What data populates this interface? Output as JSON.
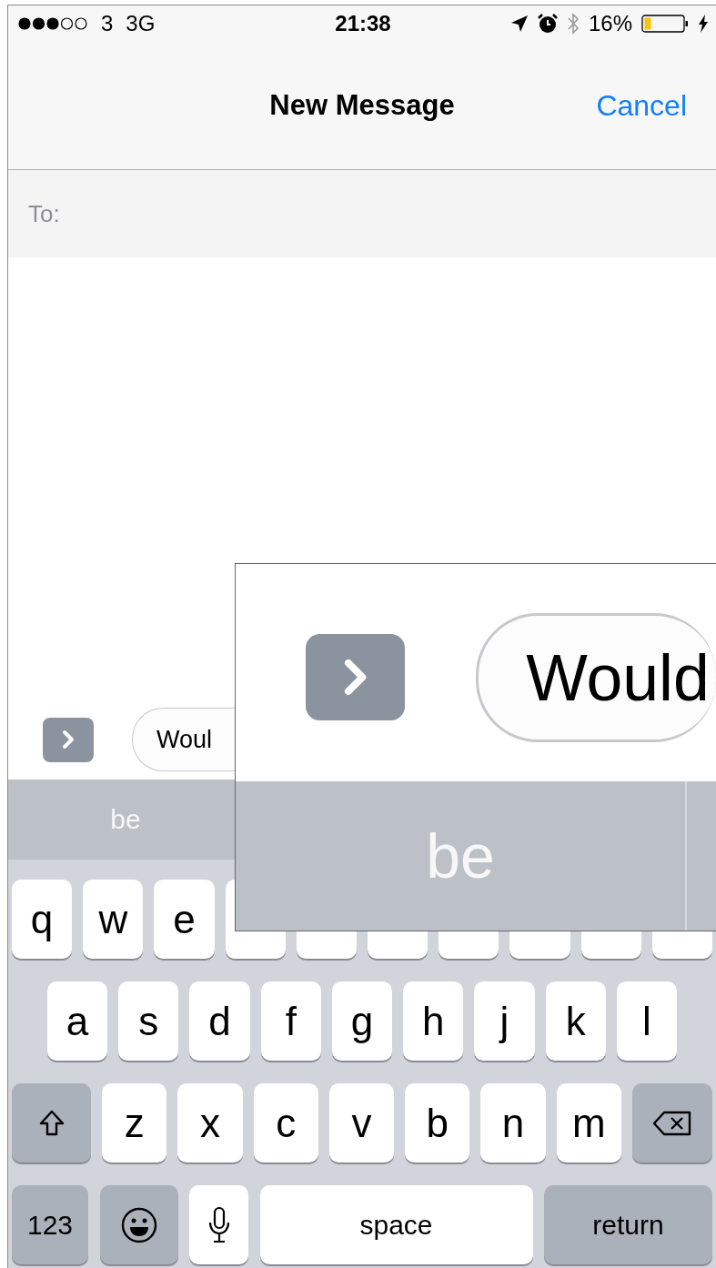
{
  "status_bar": {
    "carrier": "3",
    "network": "3G",
    "time": "21:38",
    "battery": "16%"
  },
  "nav_bar": {
    "title": "New Message",
    "cancel": "Cancel"
  },
  "recipient": {
    "label": "To:"
  },
  "composer": {
    "text": "Woul"
  },
  "suggestions": [
    {
      "label": "be"
    }
  ],
  "keyboard": {
    "rows": [
      {
        "keys": [
          {
            "kind": "letter",
            "label": "q"
          },
          {
            "kind": "letter",
            "label": "w"
          },
          {
            "kind": "letter",
            "label": "e"
          },
          {
            "kind": "covered"
          },
          {
            "kind": "covered"
          },
          {
            "kind": "covered"
          },
          {
            "kind": "covered"
          },
          {
            "kind": "covered"
          },
          {
            "kind": "covered"
          },
          {
            "kind": "covered"
          }
        ]
      },
      {
        "keys": [
          {
            "kind": "letter",
            "label": "a"
          },
          {
            "kind": "letter",
            "label": "s"
          },
          {
            "kind": "letter",
            "label": "d"
          },
          {
            "kind": "letter",
            "label": "f"
          },
          {
            "kind": "letter",
            "label": "g"
          },
          {
            "kind": "letter",
            "label": "h"
          },
          {
            "kind": "letter",
            "label": "j"
          },
          {
            "kind": "letter",
            "label": "k"
          },
          {
            "kind": "letter",
            "label": "l"
          }
        ]
      },
      {
        "keys": [
          {
            "kind": "shift"
          },
          {
            "kind": "letter",
            "label": "z"
          },
          {
            "kind": "letter",
            "label": "x"
          },
          {
            "kind": "letter",
            "label": "c"
          },
          {
            "kind": "letter",
            "label": "v"
          },
          {
            "kind": "letter",
            "label": "b"
          },
          {
            "kind": "letter",
            "label": "n"
          },
          {
            "kind": "letter",
            "label": "m"
          },
          {
            "kind": "delete"
          }
        ]
      },
      {
        "keys": [
          {
            "kind": "function",
            "label": "123"
          },
          {
            "kind": "emoji"
          },
          {
            "kind": "mic"
          },
          {
            "kind": "space",
            "label": "space"
          },
          {
            "kind": "return",
            "label": "return"
          }
        ]
      }
    ]
  },
  "magnifier": {
    "message_text": "Would",
    "suggestion": "be"
  }
}
